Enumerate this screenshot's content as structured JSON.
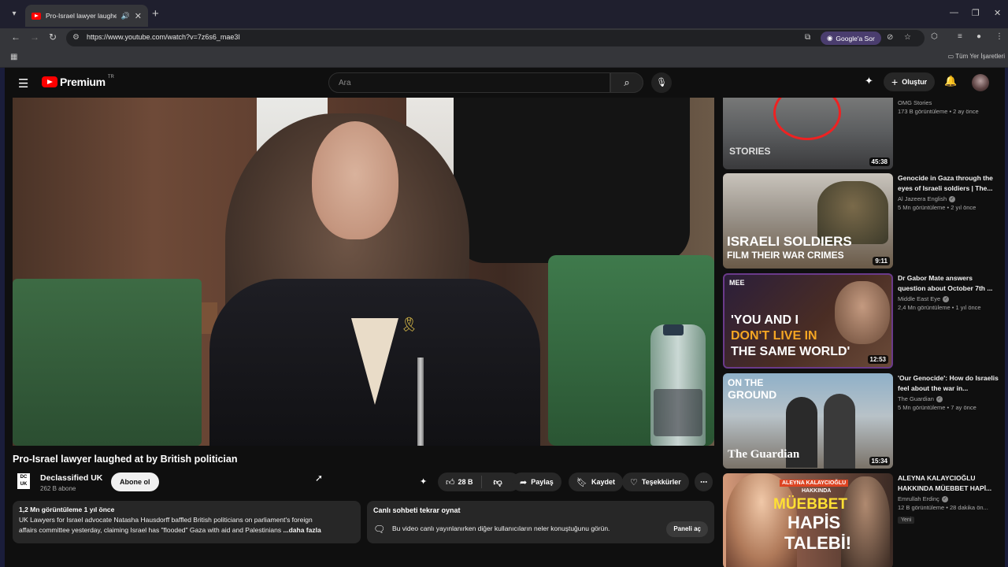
{
  "browser": {
    "tab_title": "Pro-Israel lawyer laughed at",
    "url": "https://www.youtube.com/watch?v=7z6s6_mae3I",
    "ask_label": "Google'a Sor",
    "bookmarks_all": "Tüm Yer İşaretleri"
  },
  "youtube": {
    "logo_text": "Premium",
    "logo_country": "TR",
    "search_placeholder": "Ara",
    "create_label": "Oluştur"
  },
  "video": {
    "title": "Pro-Israel lawyer laughed at by British politician",
    "channel": "Declassified UK",
    "channel_logo": "DC UK",
    "subscribers": "262 B abone",
    "subscribe_label": "Abone ol",
    "likes": "28 B",
    "share_label": "Paylaş",
    "save_label": "Kaydet",
    "thanks_label": "Teşekkürler"
  },
  "description": {
    "meta": "1,2 Mn görüntüleme  1 yıl önce",
    "line1": "UK Lawyers for Israel advocate Natasha Hausdorff baffled British politicians on parliament's foreign",
    "line2": "affairs committee yesterday, claiming Israel has \"flooded\" Gaza with aid and Palestinians",
    "more": "...daha fazla"
  },
  "chat": {
    "title": "Canlı sohbeti tekrar oynat",
    "text": "Bu video canlı yayınlanırken diğer kullanıcıların neler konuştuğunu görün.",
    "open_label": "Paneli aç"
  },
  "recommendations": [
    {
      "title": "",
      "channel": "OMG Stories",
      "meta": "173 B görüntüleme • 2 ay önce",
      "duration": "45:38",
      "thumb_text": "STORIES",
      "verified": false
    },
    {
      "title": "Genocide in Gaza through the eyes of Israeli soldiers | The...",
      "channel": "Al Jazeera English",
      "meta": "5 Mn görüntüleme • 2 yıl önce",
      "duration": "9:11",
      "thumb_line1": "ISRAELI SOLDIERS",
      "thumb_line2": "FILM THEIR WAR CRIMES",
      "verified": true
    },
    {
      "title": "Dr Gabor Mate answers question about October 7th ...",
      "channel": "Middle East Eye",
      "meta": "2,4 Mn görüntüleme • 1 yıl önce",
      "duration": "12:53",
      "thumb_line1": "'YOU AND I",
      "thumb_line2": "DON'T LIVE IN",
      "thumb_line3": "THE SAME WORLD'",
      "thumb_logo": "MEE",
      "verified": true
    },
    {
      "title": "'Our Genocide': How do Israelis feel about the war in...",
      "channel": "The Guardian",
      "meta": "5 Mn görüntüleme • 7 ay önce",
      "duration": "15:34",
      "thumb_line1": "ON THE",
      "thumb_line2": "GROUND",
      "thumb_brand": "The Guardian",
      "verified": true
    },
    {
      "title": "ALEYNA KALAYCIOĞLU HAKKINDA MÜEBBET HAPİ...",
      "channel": "Emrullah Erdinç",
      "meta": "12 B görüntüleme • 28 dakika ön...",
      "badge": "Yeni",
      "thumb_line1": "ALEYNA KALAYCIOĞLU",
      "thumb_line2": "HAKKINDA",
      "thumb_line3": "MÜEBBET",
      "thumb_line4": "HAPİS",
      "thumb_line5": "TALEBİ!",
      "verified": true
    }
  ],
  "colors": {
    "yt_red": "#ff0000",
    "bg": "#0f0f0f",
    "surface": "#272727"
  }
}
